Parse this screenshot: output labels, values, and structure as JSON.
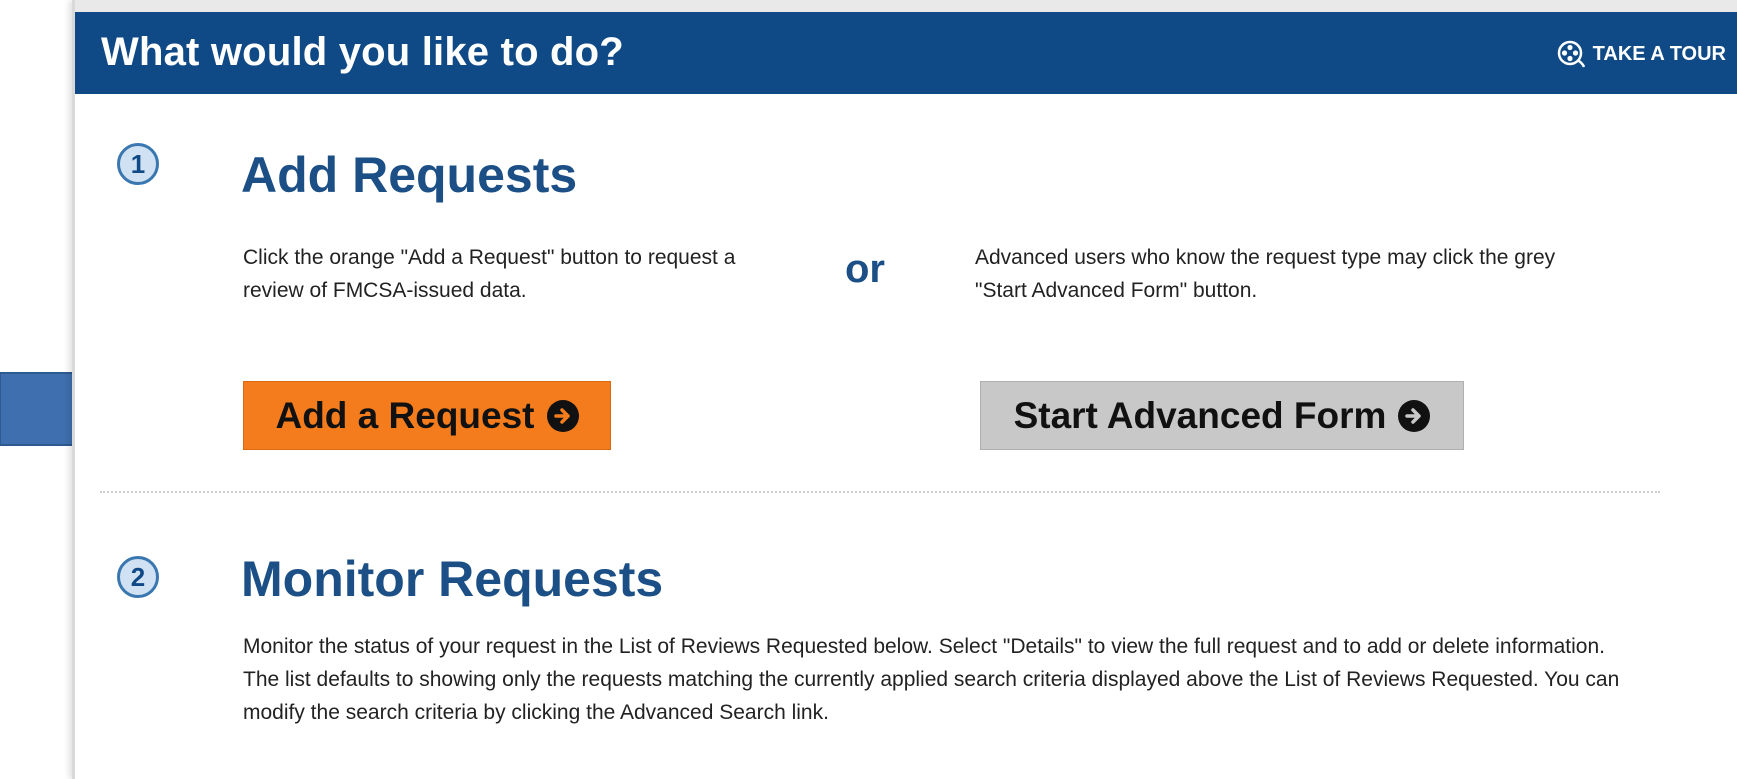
{
  "header": {
    "title": "What would you like to do?",
    "tour_label": "TAKE A TOUR",
    "tour_icon": "film-reel-icon",
    "background_color": "#104a86"
  },
  "step1": {
    "number": "1",
    "heading": "Add Requests",
    "left_text": "Click the orange \"Add a Request\" button to request a review of FMCSA-issued data.",
    "or_label": "or",
    "right_text": "Advanced users who know the request type may click the grey \"Start Advanced Form\" button.",
    "add_button_label": "Add a Request",
    "advanced_button_label": "Start Advanced Form",
    "button_icon": "arrow-circle-right-icon",
    "add_button_color": "#f47c1c",
    "advanced_button_color": "#c8c8c8"
  },
  "step2": {
    "number": "2",
    "heading": "Monitor Requests",
    "text": "Monitor the status of your request in the List of Reviews Requested below. Select \"Details\" to view the full request and to add or delete information. The list defaults to showing only the requests matching the currently applied search criteria displayed above the List of Reviews Requested. You can modify the search criteria by clicking the Advanced Search link."
  },
  "annotation": {
    "pointer_icon": "pointer-arrow-icon",
    "color": "#3f6fae"
  }
}
